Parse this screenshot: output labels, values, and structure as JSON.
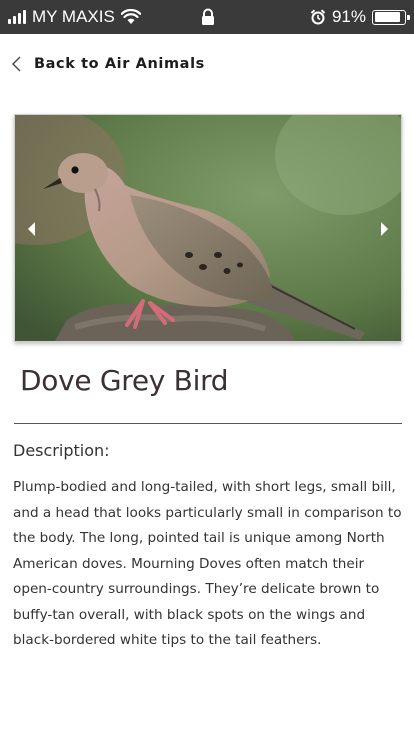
{
  "status_bar": {
    "carrier": "MY MAXIS",
    "battery_percent": "91%",
    "battery_level": 0.91
  },
  "nav": {
    "back_label": "Back to Air Animals"
  },
  "carousel": {
    "prev_icon": "chevron-left-icon",
    "next_icon": "chevron-right-icon"
  },
  "animal": {
    "name": "Dove Grey Bird",
    "description_heading": "Description:",
    "description": "Plump-bodied and long-tailed, with short legs, small bill, and a head that looks particularly small in comparison to the body. The long, pointed tail is unique among North American doves. Mourning Doves often match their open-country surroundings. They’re delicate brown to buffy-tan overall, with black spots on the wings and black-bordered white tips to the tail feathers."
  }
}
